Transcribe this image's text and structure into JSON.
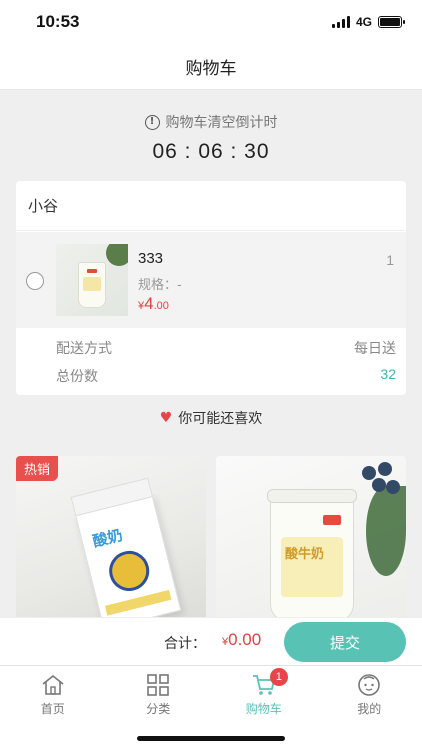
{
  "status_bar": {
    "time": "10:53",
    "network": "4G",
    "battery_level": 1.0
  },
  "nav": {
    "title": "购物车"
  },
  "countdown": {
    "label": "购物车清空倒计时",
    "time": "06 : 06 : 30"
  },
  "cart": {
    "shop_name": "小谷",
    "items": [
      {
        "name": "333",
        "quantity": "1",
        "spec": "规格：-",
        "currency": "¥",
        "price_int": "4",
        "price_dec": ".00"
      }
    ],
    "delivery_label": "配送方式",
    "delivery_value": "每日送",
    "total_count_label": "总份数",
    "total_count_value": "32"
  },
  "recommend": {
    "title": "你可能还喜欢",
    "products": [
      {
        "badge": "热销",
        "image": "yogurt-carton-image"
      },
      {
        "badge": "",
        "image": "yogurt-cup-image"
      }
    ]
  },
  "submit_bar": {
    "total_label": "合计：",
    "currency": "¥",
    "amount": "0.00",
    "submit_label": "提交"
  },
  "tabs": [
    {
      "label": "首页",
      "icon": "home-icon",
      "active": false
    },
    {
      "label": "分类",
      "icon": "category-icon",
      "active": false
    },
    {
      "label": "购物车",
      "icon": "cart-icon",
      "active": true,
      "badge": "1"
    },
    {
      "label": "我的",
      "icon": "profile-icon",
      "active": false
    }
  ],
  "colors": {
    "accent": "#58c3b5",
    "price": "#e0443e",
    "badge": "#e8454a",
    "hot": "#e8504e"
  }
}
